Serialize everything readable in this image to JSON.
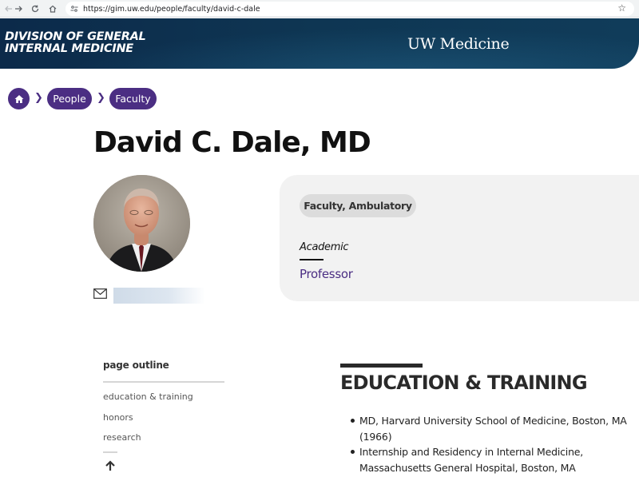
{
  "browser": {
    "url": "https://gim.uw.edu/people/faculty/david-c-dale"
  },
  "header": {
    "division_line1": "DIVISION OF GENERAL",
    "division_line2": "INTERNAL MEDICINE",
    "org": "UW Medicine"
  },
  "breadcrumb": {
    "items": [
      "People",
      "Faculty"
    ]
  },
  "profile": {
    "name": "David C. Dale, MD",
    "role": "Faculty, Ambulatory",
    "academic_label": "Academic",
    "academic_title": "Professor"
  },
  "outline": {
    "title": "page outline",
    "items": [
      "education & training",
      "honors",
      "research"
    ]
  },
  "education": {
    "heading": "EDUCATION & TRAINING",
    "items": [
      "MD, Harvard University School of Medicine, Boston, MA (1966)",
      "Internship and Residency in Internal Medicine, Massachusetts General Hospital, Boston, MA"
    ]
  },
  "colors": {
    "brand_purple": "#4b2e83",
    "banner_navy": "#0c2a4a"
  },
  "icons": {
    "home": "home-icon",
    "mail": "mail-icon",
    "top": "arrow-up-icon",
    "bookmark": "star-icon"
  }
}
